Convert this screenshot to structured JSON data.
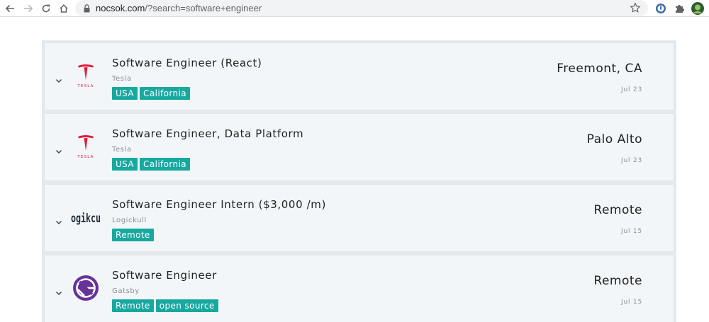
{
  "browser": {
    "url_host": "nocsok.com",
    "url_rest": "/?search=software+engineer",
    "icons": [
      "back-icon",
      "forward-icon",
      "reload-icon",
      "home-icon",
      "lock-icon",
      "star-icon",
      "extension-icon",
      "puzzle-icon",
      "avatar"
    ]
  },
  "colors": {
    "tag": "#17a8a0",
    "tesla_red": "#e31937",
    "gatsby_purple": "#663399"
  },
  "jobs": [
    {
      "title": "Software Engineer (React)",
      "company": "Tesla",
      "logo": "tesla-logo",
      "logo_text": "TESLA",
      "tags": [
        "USA",
        "California"
      ],
      "location": "Freemont, CA",
      "date": "Jul 23"
    },
    {
      "title": "Software Engineer, Data Platform",
      "company": "Tesla",
      "logo": "tesla-logo",
      "logo_text": "TESLA",
      "tags": [
        "USA",
        "California"
      ],
      "location": "Palo Alto",
      "date": "Jul 23"
    },
    {
      "title": "Software Engineer Intern ($3,000 /m)",
      "company": "Logickull",
      "logo": "logickull-logo",
      "logo_text": "ogikcu",
      "tags": [
        "Remote"
      ],
      "location": "Remote",
      "date": "Jul 15"
    },
    {
      "title": "Software Engineer",
      "company": "Gatsby",
      "logo": "gatsby-logo",
      "tags": [
        "Remote",
        "open source"
      ],
      "location": "Remote",
      "date": "Jul 15"
    }
  ]
}
